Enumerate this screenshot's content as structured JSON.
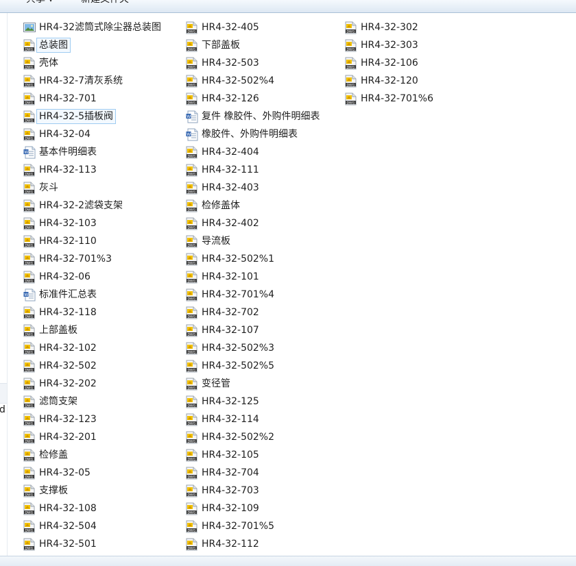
{
  "toolbar": {
    "share_label": "共享 ▾",
    "new_folder_label": "新建文件夹"
  },
  "left_pane": {
    "cut_text": "d"
  },
  "columns": [
    [
      {
        "name": "HR4-32滤筒式除尘器总装图",
        "icon": "image-file-icon"
      },
      {
        "name": "总装图",
        "icon": "dwg-file-icon",
        "selected": true
      },
      {
        "name": "壳体",
        "icon": "dwg-file-icon"
      },
      {
        "name": "HR4-32-7清灰系统",
        "icon": "dwg-file-icon"
      },
      {
        "name": "HR4-32-701",
        "icon": "dwg-file-icon"
      },
      {
        "name": "HR4-32-5插板阀",
        "icon": "dwg-file-icon",
        "selected": true
      },
      {
        "name": "HR4-32-04",
        "icon": "dwg-file-icon"
      },
      {
        "name": "基本件明细表",
        "icon": "word-doc-icon"
      },
      {
        "name": "HR4-32-113",
        "icon": "dwg-file-icon"
      },
      {
        "name": "灰斗",
        "icon": "dwg-file-icon"
      },
      {
        "name": "HR4-32-2滤袋支架",
        "icon": "dwg-file-icon"
      },
      {
        "name": "HR4-32-103",
        "icon": "dwg-file-icon"
      },
      {
        "name": "HR4-32-110",
        "icon": "dwg-file-icon"
      },
      {
        "name": "HR4-32-701%3",
        "icon": "dwg-file-icon"
      },
      {
        "name": "HR4-32-06",
        "icon": "dwg-file-icon"
      },
      {
        "name": "标准件汇总表",
        "icon": "word-doc-icon"
      },
      {
        "name": "HR4-32-118",
        "icon": "dwg-file-icon"
      },
      {
        "name": "上部盖板",
        "icon": "dwg-file-icon"
      },
      {
        "name": "HR4-32-102",
        "icon": "dwg-file-icon"
      },
      {
        "name": "HR4-32-502",
        "icon": "dwg-file-icon"
      },
      {
        "name": "HR4-32-202",
        "icon": "dwg-file-icon"
      },
      {
        "name": "滤筒支架",
        "icon": "dwg-file-icon"
      },
      {
        "name": "HR4-32-123",
        "icon": "dwg-file-icon"
      },
      {
        "name": "HR4-32-201",
        "icon": "dwg-file-icon"
      },
      {
        "name": "检修盖",
        "icon": "dwg-file-icon"
      },
      {
        "name": "HR4-32-05",
        "icon": "dwg-file-icon"
      },
      {
        "name": "支撑板",
        "icon": "dwg-file-icon"
      },
      {
        "name": "HR4-32-108",
        "icon": "dwg-file-icon"
      },
      {
        "name": "HR4-32-504",
        "icon": "dwg-file-icon"
      },
      {
        "name": "HR4-32-501",
        "icon": "dwg-file-icon"
      }
    ],
    [
      {
        "name": "HR4-32-405",
        "icon": "dwg-file-icon"
      },
      {
        "name": "下部盖板",
        "icon": "dwg-file-icon"
      },
      {
        "name": "HR4-32-503",
        "icon": "dwg-file-icon"
      },
      {
        "name": "HR4-32-502%4",
        "icon": "dwg-file-icon"
      },
      {
        "name": "HR4-32-126",
        "icon": "dwg-file-icon"
      },
      {
        "name": "复件 橡胶件、外购件明细表",
        "icon": "word-doc-icon"
      },
      {
        "name": "橡胶件、外购件明细表",
        "icon": "word-doc-icon"
      },
      {
        "name": "HR4-32-404",
        "icon": "dwg-file-icon"
      },
      {
        "name": "HR4-32-111",
        "icon": "dwg-file-icon"
      },
      {
        "name": "HR4-32-403",
        "icon": "dwg-file-icon"
      },
      {
        "name": "检修盖体",
        "icon": "dwg-file-icon"
      },
      {
        "name": "HR4-32-402",
        "icon": "dwg-file-icon"
      },
      {
        "name": "导流板",
        "icon": "dwg-file-icon"
      },
      {
        "name": "HR4-32-502%1",
        "icon": "dwg-file-icon"
      },
      {
        "name": "HR4-32-101",
        "icon": "dwg-file-icon"
      },
      {
        "name": "HR4-32-701%4",
        "icon": "dwg-file-icon"
      },
      {
        "name": "HR4-32-702",
        "icon": "dwg-file-icon"
      },
      {
        "name": "HR4-32-107",
        "icon": "dwg-file-icon"
      },
      {
        "name": "HR4-32-502%3",
        "icon": "dwg-file-icon"
      },
      {
        "name": "HR4-32-502%5",
        "icon": "dwg-file-icon"
      },
      {
        "name": "变径管",
        "icon": "dwg-file-icon"
      },
      {
        "name": "HR4-32-125",
        "icon": "dwg-file-icon"
      },
      {
        "name": "HR4-32-114",
        "icon": "dwg-file-icon"
      },
      {
        "name": "HR4-32-502%2",
        "icon": "dwg-file-icon"
      },
      {
        "name": "HR4-32-105",
        "icon": "dwg-file-icon"
      },
      {
        "name": "HR4-32-704",
        "icon": "dwg-file-icon"
      },
      {
        "name": "HR4-32-703",
        "icon": "dwg-file-icon"
      },
      {
        "name": "HR4-32-109",
        "icon": "dwg-file-icon"
      },
      {
        "name": "HR4-32-701%5",
        "icon": "dwg-file-icon"
      },
      {
        "name": "HR4-32-112",
        "icon": "dwg-file-icon"
      }
    ],
    [
      {
        "name": "HR4-32-302",
        "icon": "dwg-file-icon"
      },
      {
        "name": "HR4-32-303",
        "icon": "dwg-file-icon"
      },
      {
        "name": "HR4-32-106",
        "icon": "dwg-file-icon"
      },
      {
        "name": "HR4-32-120",
        "icon": "dwg-file-icon"
      },
      {
        "name": "HR4-32-701%6",
        "icon": "dwg-file-icon"
      }
    ]
  ],
  "colors": {
    "dwg_yellow": "#f2c200",
    "dwg_band": "#3a3a3a",
    "selection_border": "#9ecbf1",
    "toolbar_top": "#f5f9fd",
    "toolbar_bottom": "#dde8f3"
  }
}
